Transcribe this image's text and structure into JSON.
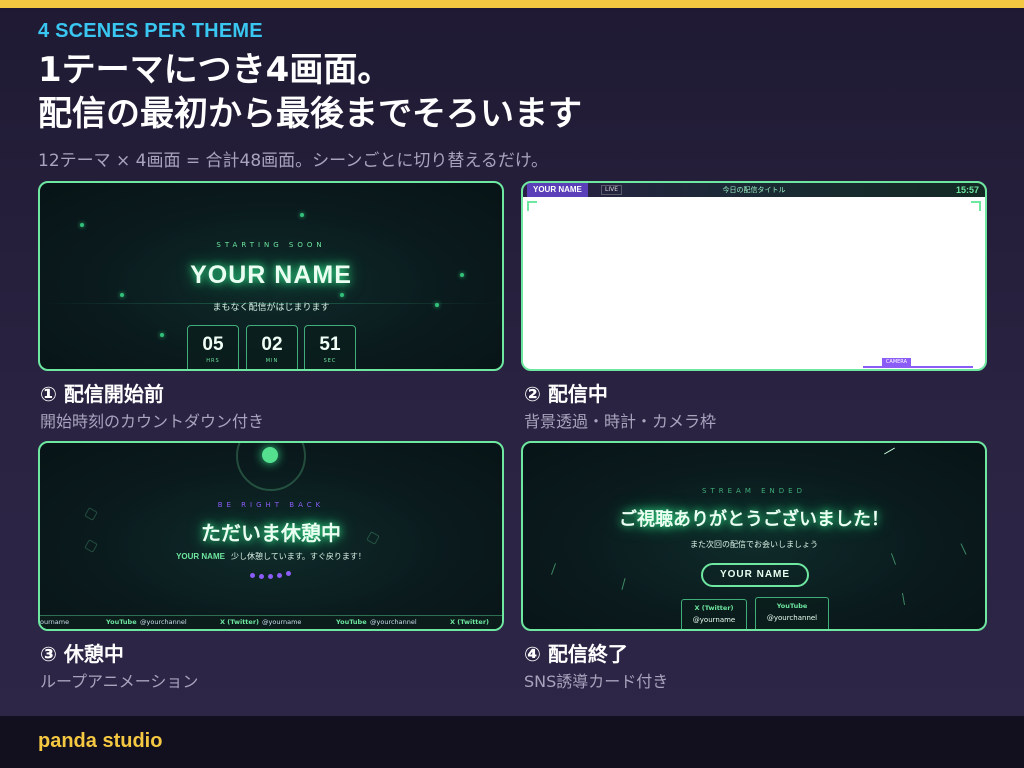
{
  "header": {
    "eyebrow": "4 SCENES PER THEME",
    "headline_line1": "1テーマにつき4画面。",
    "headline_line2": "配信の最初から最後までそろいます",
    "subline": "12テーマ × 4画面 = 合計48画面。シーンごとに切り替えるだけ。"
  },
  "scenes": [
    {
      "title": "① 配信開始前",
      "desc": "開始時刻のカウントダウン付き",
      "label": "STARTING SOON",
      "name": "YOUR NAME",
      "message": "まもなく配信がはじまります",
      "countdown": [
        {
          "value": "05",
          "unit": "HRS"
        },
        {
          "value": "02",
          "unit": "MIN"
        },
        {
          "value": "51",
          "unit": "SEC"
        }
      ]
    },
    {
      "title": "② 配信中",
      "desc": "背景透過・時計・カメラ枠",
      "name": "YOUR NAME",
      "live": "LIVE",
      "stream_title": "今日の配信タイトル",
      "time": "15:57",
      "camera": "CAMERA"
    },
    {
      "title": "③ 休憩中",
      "desc": "ループアニメーション",
      "label": "BE RIGHT BACK",
      "main": "ただいま休憩中",
      "name": "YOUR NAME",
      "message": "少し休憩しています。すぐ戻ります！",
      "ticker": [
        {
          "handle": "ourname"
        },
        {
          "label": "YouTube",
          "handle": "@yourchannel"
        },
        {
          "label": "X (Twitter)",
          "handle": "@yourname"
        },
        {
          "label": "YouTube",
          "handle": "@yourchannel"
        },
        {
          "label": "X (Twitter)",
          "handle": "@yourname"
        }
      ]
    },
    {
      "title": "④ 配信終了",
      "desc": "SNS誘導カード付き",
      "label": "STREAM ENDED",
      "main": "ご視聴ありがとうございました！",
      "message": "また次回の配信でお会いしましょう",
      "name": "YOUR NAME",
      "sns": [
        {
          "label": "X (Twitter)",
          "handle": "@yourname"
        },
        {
          "label": "YouTube",
          "handle": "@yourchannel"
        }
      ]
    }
  ],
  "footer": {
    "brand": "panda studio"
  },
  "colors": {
    "accent_yellow": "#f5c842",
    "eyebrow_blue": "#39c6f0",
    "frame_green": "#6ee7a0",
    "purple": "#8b5cf6"
  }
}
